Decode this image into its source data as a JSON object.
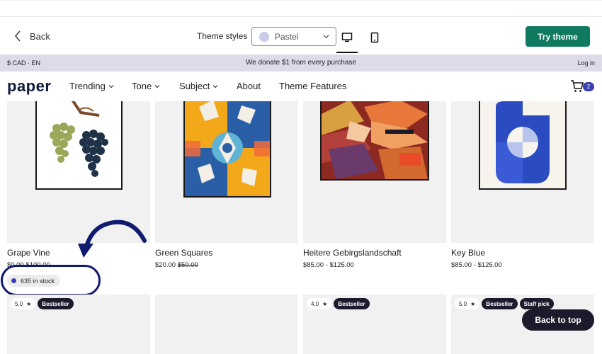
{
  "editor": {
    "back_label": "Back",
    "theme_styles_label": "Theme styles",
    "theme_select_value": "Pastel",
    "try_theme_label": "Try theme"
  },
  "announcement": {
    "currency_lang": "$ CAD · EN",
    "message": "We donate $1 from every purchase",
    "login": "Log in"
  },
  "store": {
    "logo": "paper",
    "nav": [
      "Trending",
      "Tone",
      "Subject",
      "About",
      "Theme Features"
    ],
    "cart_count": "2"
  },
  "products": [
    {
      "title": "Grape Vine",
      "price": "$0.00",
      "compare": "$100.00"
    },
    {
      "title": "Green Squares",
      "price": "$20.00",
      "compare": "$50.00"
    },
    {
      "title": "Heitere Gebirgslandschaft",
      "price": "$85.00  - $125.00",
      "compare": ""
    },
    {
      "title": "Key Blue",
      "price": "$85.00  - $125.00",
      "compare": ""
    }
  ],
  "stock": {
    "label": "635 in stock"
  },
  "row2": [
    {
      "rating": "5.0",
      "tags": [
        "Bestseller"
      ]
    },
    {
      "rating": "",
      "tags": []
    },
    {
      "rating": "4.0",
      "tags": [
        "Bestseller"
      ]
    },
    {
      "rating": "5.0",
      "tags": [
        "Bestseller",
        "Staff pick"
      ]
    }
  ],
  "back_to_top": "Back to top",
  "colors": {
    "accent_green": "#0f7a5f",
    "accent_indigo": "#3c3eb0",
    "annotation_navy": "#101a6e"
  }
}
